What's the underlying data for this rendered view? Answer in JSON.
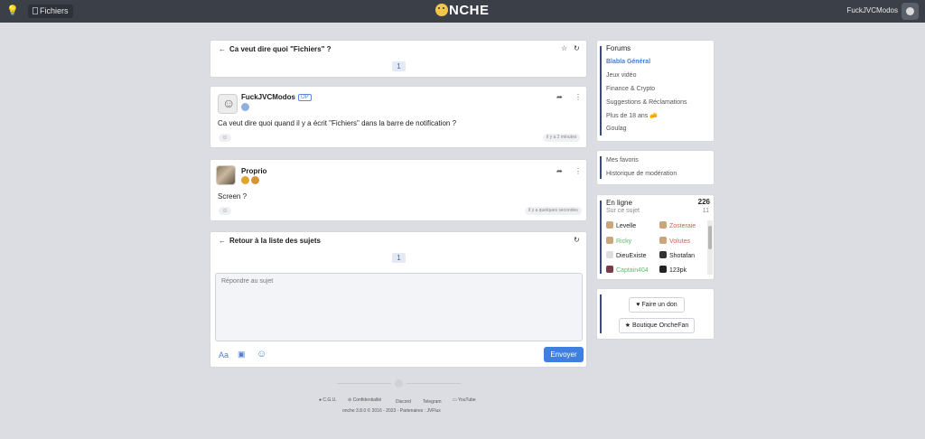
{
  "topbar": {
    "files_label": "Fichiers",
    "logo_text": "NCHE",
    "username": "FuckJVCModos"
  },
  "topic": {
    "title": "Ca veut dire quoi \"Fichiers\" ?",
    "page": "1"
  },
  "posts": [
    {
      "author": "FuckJVCModos",
      "op_badge": "OP",
      "text": "Ca veut dire quoi quand il y a écrit \"Fichiers\" dans la barre de notification ?",
      "time": "il y a 2 minutes"
    },
    {
      "author": "Proprio",
      "text": "Screen ?",
      "time": "il y a quelques secondes"
    }
  ],
  "reply": {
    "back_label": "Retour à la liste des sujets",
    "page": "1",
    "placeholder": "Répondre au sujet",
    "font_tool": "Aa",
    "send_label": "Envoyer"
  },
  "forums": {
    "title": "Forums",
    "items": [
      {
        "label": "Blabla Général",
        "active": true
      },
      {
        "label": "Jeux vidéo"
      },
      {
        "label": "Finance & Crypto"
      },
      {
        "label": "Suggestions & Réclamations"
      },
      {
        "label": "Plus de 18 ans 🧀"
      },
      {
        "label": "Goulag"
      }
    ]
  },
  "links": {
    "favorites": "Mes favoris",
    "moderation": "Historique de modération"
  },
  "online": {
    "title": "En ligne",
    "count": "226",
    "sub_label": "Sur ce sujet",
    "sub_count": "11",
    "users": [
      {
        "name": "Levelle",
        "color": "#222222"
      },
      {
        "name": "Zosteraie",
        "color": "#e05b4b"
      },
      {
        "name": "Ricky",
        "color": "#5dbb6b"
      },
      {
        "name": "Volutes",
        "color": "#e05b4b"
      },
      {
        "name": "DieuExiste",
        "color": "#222222"
      },
      {
        "name": "Shotafan",
        "color": "#222222"
      },
      {
        "name": "Captain404",
        "color": "#5dbb6b"
      },
      {
        "name": "123pk",
        "color": "#222222"
      }
    ]
  },
  "support": {
    "donate_label": "Faire un don",
    "shop_label": "Boutique OncheFan"
  },
  "footer": {
    "links": [
      "C.G.U.",
      "Confidentialité",
      "Discord",
      "Telegram",
      "YouTube"
    ],
    "copyright": "onche 3.8.0 © 2016 - 2023 - Partenaires : JVFlux"
  }
}
